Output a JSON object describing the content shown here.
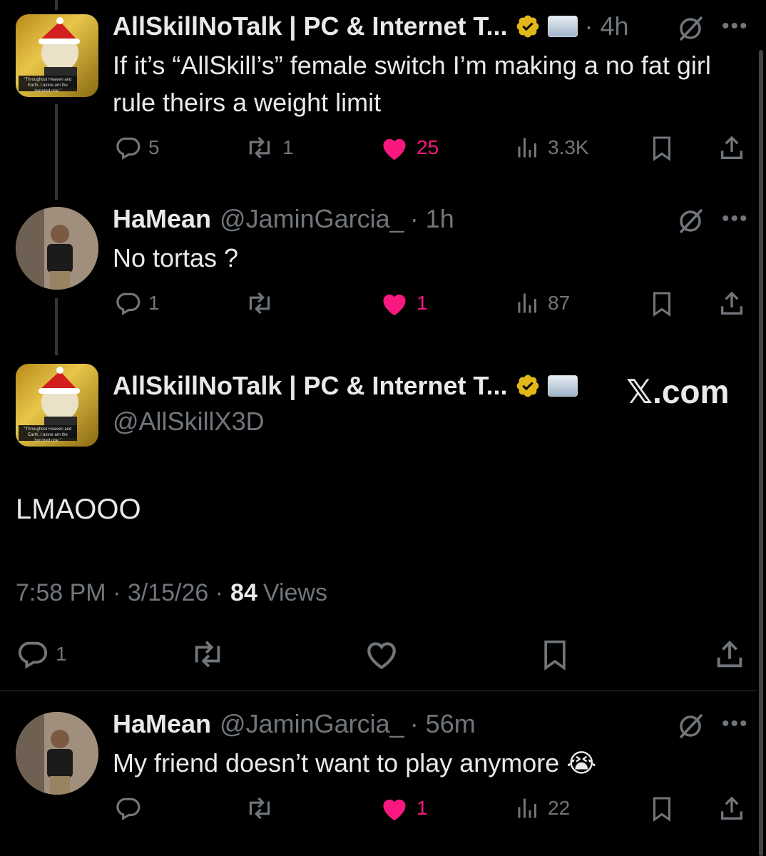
{
  "tweet1": {
    "name": "AllSkillNoTalk | PC & Internet T...",
    "time": "· 4h",
    "text": "If it’s “AllSkill’s” female switch I’m making a no fat girl rule theirs a weight limit",
    "replies": "5",
    "reposts": "1",
    "likes": "25",
    "views": "3.3K",
    "avatar_caption": "“Throughout Heaven and Earth, I alone am the honored one.”"
  },
  "tweet2": {
    "name": "HaMean",
    "handle": "@JaminGarcia_",
    "time": "· 1h",
    "text": "No tortas ?",
    "replies": "1",
    "likes": "1",
    "views": "87"
  },
  "main_tweet": {
    "name": "AllSkillNoTalk | PC & Internet T...",
    "handle": "@AllSkillX3D",
    "brand": "𝕏.com",
    "text": "LMAOOO",
    "timestamp": "7:58 PM · 3/15/26 ·",
    "views_count": "84",
    "views_label": "Views",
    "replies": "1"
  },
  "tweet4": {
    "name": "HaMean",
    "handle": "@JaminGarcia_",
    "time": "· 56m",
    "text": "My friend doesn’t want to play anymore 😭",
    "likes": "1",
    "views": "22"
  },
  "colors": {
    "background": "#000000",
    "text": "#e7e9ea",
    "muted": "#71767b",
    "like_pink": "#f91880",
    "verified_gold": "#e2b719"
  }
}
